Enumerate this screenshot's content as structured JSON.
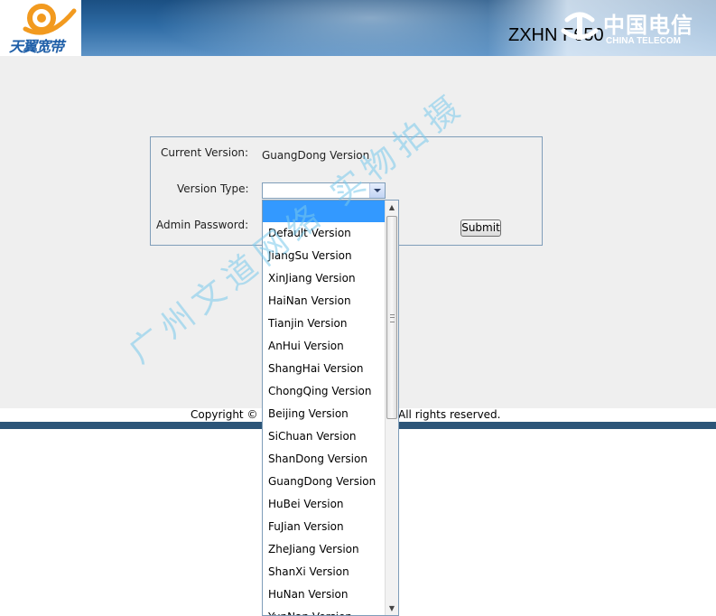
{
  "header": {
    "brand_logo_text": "天翼宽带",
    "model": "ZXHN F650",
    "carrier_cn": "中国电信",
    "carrier_en": "CHINA TELECOM"
  },
  "form": {
    "current_version_label": "Current Version:",
    "current_version_value": "GuangDong Version",
    "version_type_label": "Version Type:",
    "version_type_value": "",
    "admin_password_label": "Admin Password:",
    "submit_label": "Submit"
  },
  "dropdown": {
    "options": [
      "",
      "Default Version",
      "JiangSu Version",
      "XinJiang Version",
      "HaiNan Version",
      "Tianjin Version",
      "AnHui Version",
      "ShangHai Version",
      "ChongQing Version",
      "Beijing Version",
      "SiChuan Version",
      "ShanDong Version",
      "GuangDong Version",
      "HuBei Version",
      "FuJian Version",
      "ZheJiang Version",
      "ShanXi Version",
      "HuNan Version",
      "YunNan Version"
    ],
    "highlighted_index": 0,
    "highlight_color": "#3399ff"
  },
  "footer": {
    "copyright_left": "Copyright ©",
    "copyright_right": "All rights reserved."
  },
  "watermark": "广州文道网络 实物拍摄",
  "colors": {
    "header_blue": "#2d6aa3",
    "footer_bar": "#2c5578",
    "logo_orange": "#f29a1f",
    "logo_blue": "#1f5fa8"
  }
}
